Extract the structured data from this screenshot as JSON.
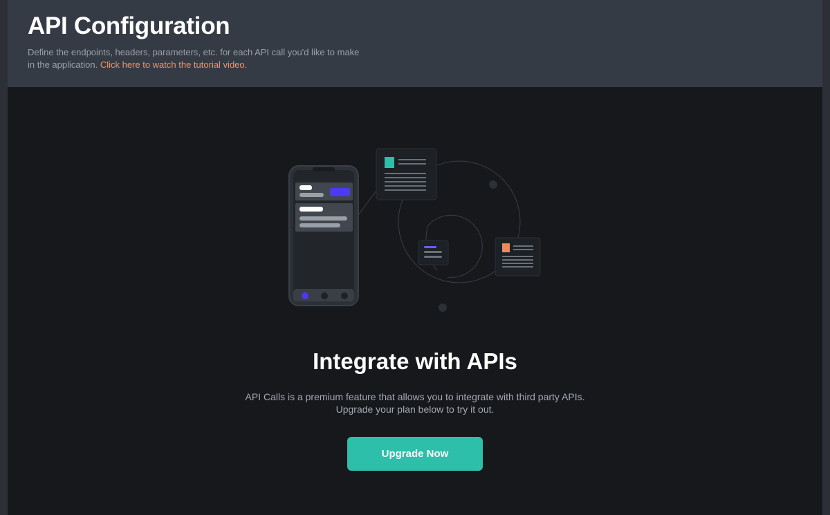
{
  "header": {
    "title": "API Configuration",
    "description": "Define the endpoints, headers, parameters, etc. for each API call you'd like to make in the application.",
    "tutorial_link": "Click here to watch the tutorial video."
  },
  "main": {
    "heading": "Integrate with APIs",
    "subtext": "API Calls is a premium feature that allows you to integrate with third party APIs. Upgrade your plan below to try it out.",
    "upgrade_label": "Upgrade Now"
  },
  "colors": {
    "accent": "#2dbfa9",
    "link": "#f39268",
    "purple": "#4a3af0",
    "orange": "#ee8a5a",
    "teal": "#2dbfa9"
  },
  "icons": {
    "illustration": "phone-api-illustration"
  }
}
